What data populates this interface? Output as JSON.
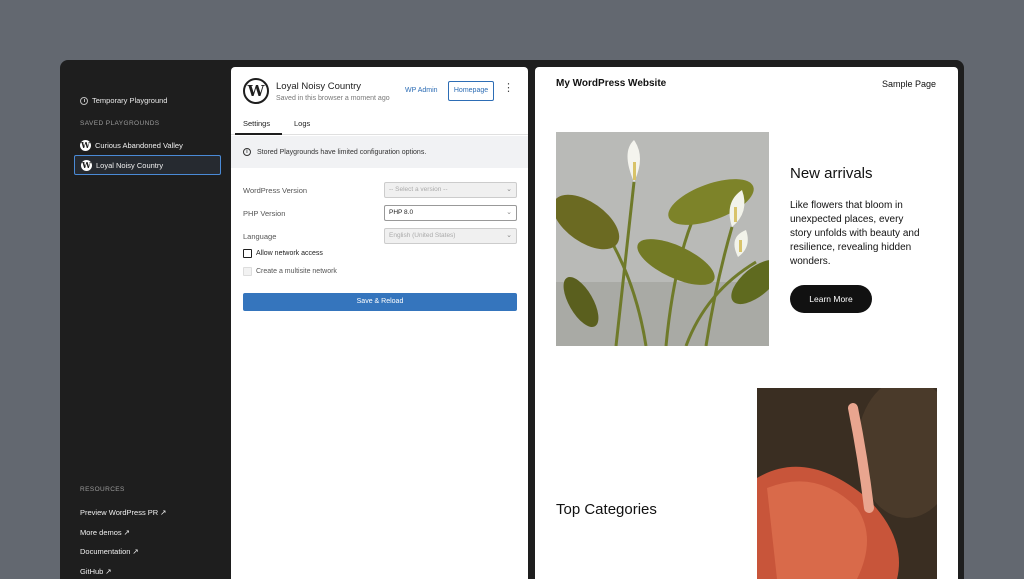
{
  "sidebar": {
    "temporary": "Temporary Playground",
    "saved_title": "SAVED PLAYGROUNDS",
    "playgrounds": [
      "Curious Abandoned Valley",
      "Loyal Noisy Country"
    ],
    "resources_title": "RESOURCES",
    "resources": [
      "Preview WordPress PR ↗",
      "More demos ↗",
      "Documentation ↗",
      "GitHub ↗"
    ]
  },
  "panel": {
    "logo": "W",
    "title": "Loyal Noisy Country",
    "subtitle": "Saved in this browser a moment ago",
    "wp_admin": "WP Admin",
    "homepage": "Homepage",
    "more": "⋮",
    "tabs": [
      "Settings",
      "Logs"
    ],
    "notice": "Stored Playgrounds have limited configuration options.",
    "info": "i",
    "fields": [
      {
        "label": "WordPress Version",
        "value": "-- Select a version --"
      },
      {
        "label": "PHP Version",
        "value": "PHP 8.0"
      },
      {
        "label": "Language",
        "value": "English (United States)"
      }
    ],
    "checkboxes": [
      "Allow network access",
      "Create a multisite network"
    ],
    "save": "Save & Reload"
  },
  "preview": {
    "site_title": "My WordPress Website",
    "nav": "Sample Page",
    "arrivals_title": "New arrivals",
    "arrivals_text": "Like flowers that bloom in unexpected places, every story unfolds with beauty and resilience, revealing hidden wonders.",
    "learn_more": "Learn More",
    "categories_title": "Top Categories"
  },
  "colors": {
    "accent": "#3575bd",
    "sidebar_bg": "#1e1e1e",
    "page_bg": "#636870"
  }
}
